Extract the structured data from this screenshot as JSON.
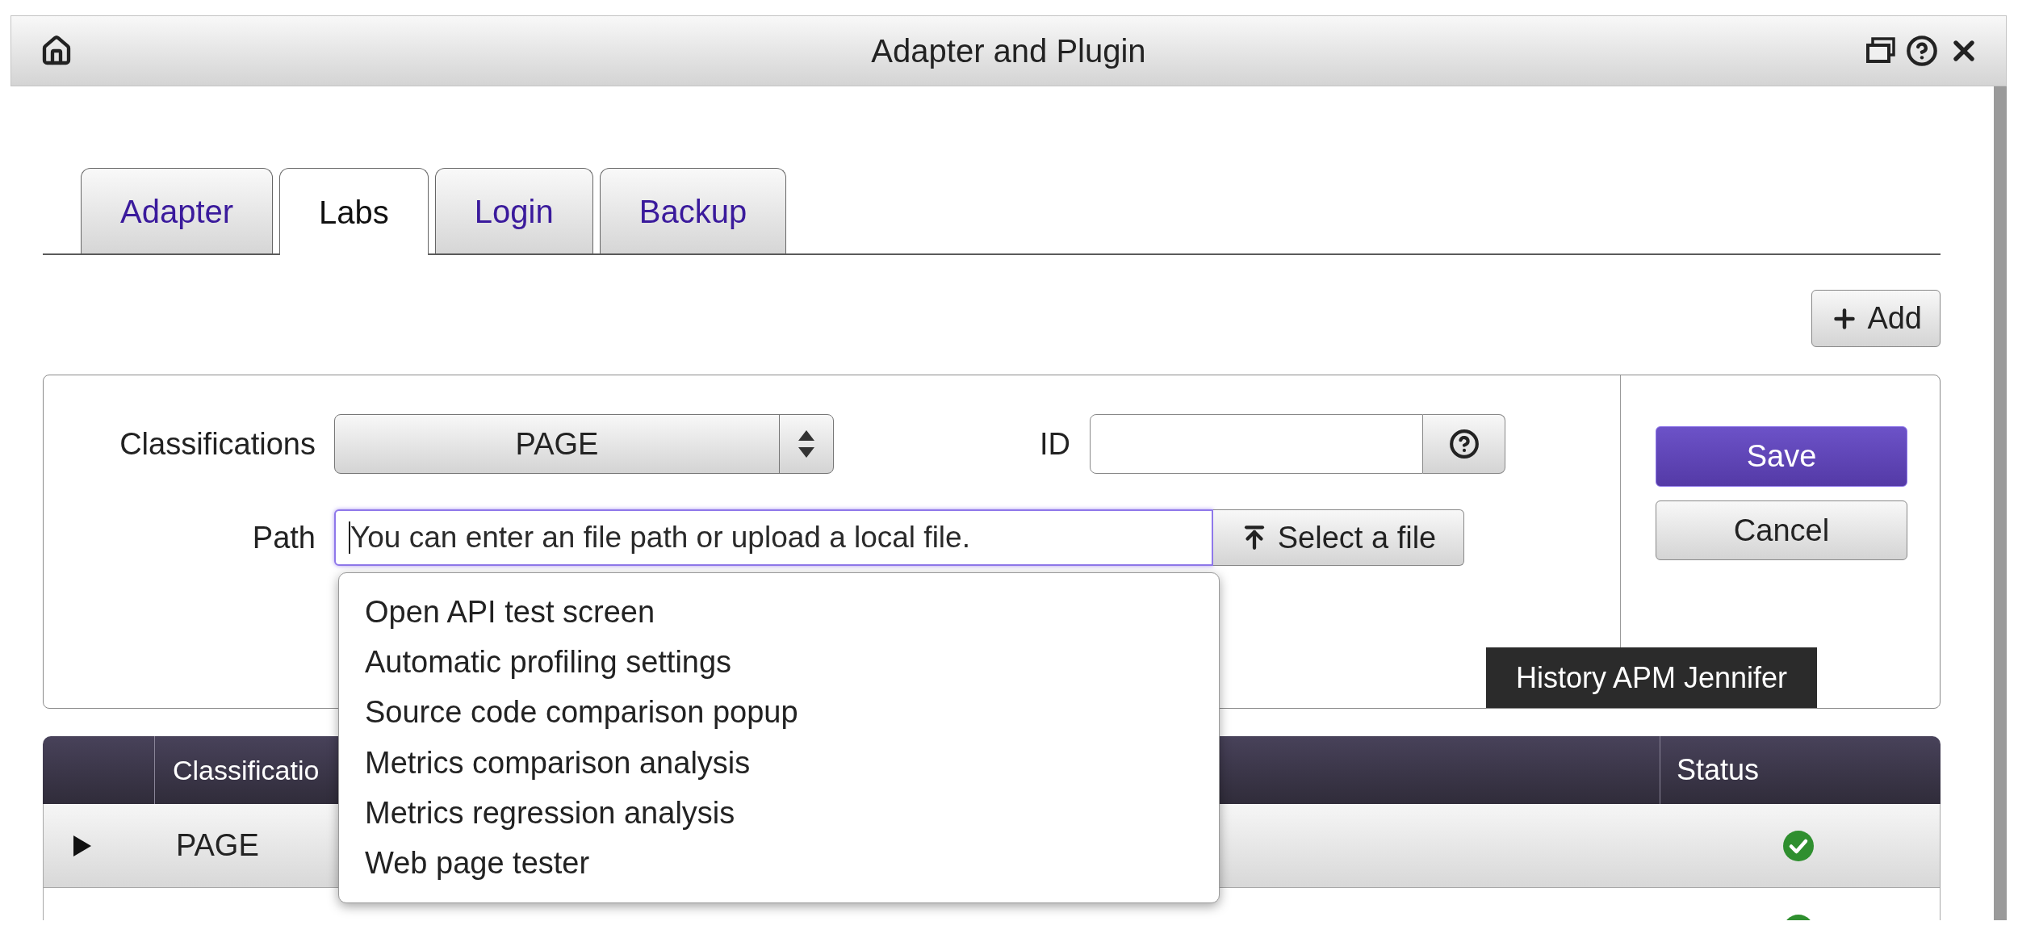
{
  "window": {
    "title": "Adapter and Plugin"
  },
  "tabs": [
    {
      "label": "Adapter",
      "selected": false
    },
    {
      "label": "Labs",
      "selected": true
    },
    {
      "label": "Login",
      "selected": false
    },
    {
      "label": "Backup",
      "selected": false
    }
  ],
  "toolbar": {
    "add_button": "Add"
  },
  "form": {
    "classification": {
      "label": "Classifications",
      "value": "PAGE"
    },
    "id": {
      "label": "ID"
    },
    "path": {
      "label": "Path",
      "placeholder": "You can enter an file path or upload a local file.",
      "button": "Select a file"
    },
    "buttons": [
      {
        "label": "Save",
        "kind": "primary"
      },
      {
        "label": "Cancel",
        "kind": "secondary"
      }
    ]
  },
  "path_suggestions": {
    "items": [
      "Open API test screen",
      "Automatic profiling settings",
      "Source code comparison popup",
      "Metrics comparison analysis",
      "Metrics regression analysis",
      "Web page tester"
    ]
  },
  "tooltip": {
    "text": "History APM Jennifer"
  },
  "table": {
    "columns": [
      {
        "label": "Classificatio"
      },
      {
        "label": "Status"
      }
    ],
    "rows": [
      {
        "expanded": false,
        "classification": "PAGE",
        "passed": true
      },
      {
        "passed": true
      }
    ]
  }
}
